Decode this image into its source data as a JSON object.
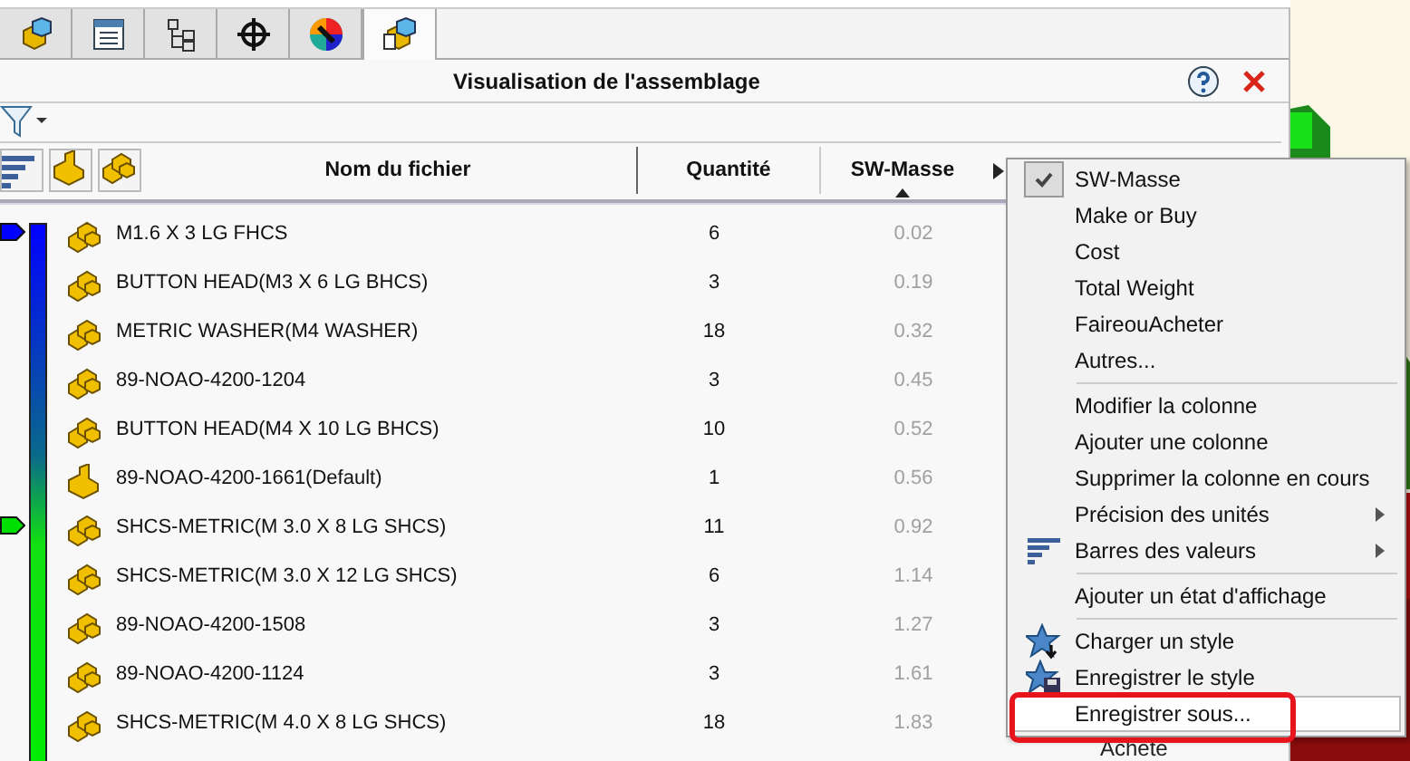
{
  "tabs": [
    {
      "selected": false
    },
    {
      "selected": false
    },
    {
      "selected": false
    },
    {
      "selected": false
    },
    {
      "selected": false
    },
    {
      "selected": true
    }
  ],
  "panel": {
    "title": "Visualisation de l'assemblage"
  },
  "table": {
    "columns": [
      {
        "label": "Nom du fichier",
        "sorted": false
      },
      {
        "label": "Quantité",
        "sorted": false
      },
      {
        "label": "SW-Masse",
        "sorted": true
      }
    ],
    "rows": [
      {
        "kind": "multi",
        "name": "M1.6 X 3 LG FHCS",
        "qty": "6",
        "mass": "0.02",
        "marker": true,
        "color": "#0000ff"
      },
      {
        "kind": "multi",
        "name": "BUTTON HEAD(M3 X 6 LG BHCS)",
        "qty": "3",
        "mass": "0.19",
        "marker": false
      },
      {
        "kind": "multi",
        "name": "METRIC WASHER(M4 WASHER)",
        "qty": "18",
        "mass": "0.32",
        "marker": false
      },
      {
        "kind": "multi",
        "name": "89-NOAO-4200-1204",
        "qty": "3",
        "mass": "0.45",
        "marker": false
      },
      {
        "kind": "multi",
        "name": "BUTTON HEAD(M4 X 10 LG BHCS)",
        "qty": "10",
        "mass": "0.52",
        "marker": false
      },
      {
        "kind": "part",
        "name": "89-NOAO-4200-1661(Default)",
        "qty": "1",
        "mass": "0.56",
        "marker": false
      },
      {
        "kind": "multi",
        "name": "SHCS-METRIC(M 3.0  X 8 LG SHCS)",
        "qty": "11",
        "mass": "0.92",
        "marker": true,
        "color": "#00e000"
      },
      {
        "kind": "multi",
        "name": "SHCS-METRIC(M 3.0  X 12 LG SHCS)",
        "qty": "6",
        "mass": "1.14",
        "marker": false
      },
      {
        "kind": "multi",
        "name": "89-NOAO-4200-1508",
        "qty": "3",
        "mass": "1.27",
        "marker": false
      },
      {
        "kind": "multi",
        "name": "89-NOAO-4200-1124",
        "qty": "3",
        "mass": "1.61",
        "marker": false
      },
      {
        "kind": "multi",
        "name": "SHCS-METRIC(M 4.0 X 8 LG SHCS)",
        "qty": "18",
        "mass": "1.83",
        "marker": false
      }
    ]
  },
  "menu": {
    "items": [
      {
        "kind": "check",
        "label": "SW-Masse",
        "checked": true,
        "selected": false,
        "circled": false
      },
      {
        "kind": "plain",
        "label": "Make or Buy",
        "selected": false,
        "circled": false
      },
      {
        "kind": "plain",
        "label": "Cost",
        "selected": false,
        "circled": false
      },
      {
        "kind": "plain",
        "label": "Total Weight",
        "selected": false,
        "circled": false
      },
      {
        "kind": "plain",
        "label": "FaireouAcheter",
        "selected": false,
        "circled": false
      },
      {
        "kind": "plain",
        "label": "Autres...",
        "selected": false,
        "circled": false
      },
      {
        "kind": "separator"
      },
      {
        "kind": "plain",
        "label": "Modifier la colonne",
        "selected": false,
        "circled": false
      },
      {
        "kind": "plain",
        "label": "Ajouter une colonne",
        "selected": false,
        "circled": false
      },
      {
        "kind": "plain",
        "label": "Supprimer la colonne en cours",
        "selected": false,
        "circled": false
      },
      {
        "kind": "submenu",
        "label": "Précision des unités",
        "selected": false,
        "circled": false
      },
      {
        "kind": "bars-submenu",
        "label": "Barres des valeurs",
        "selected": false,
        "circled": false
      },
      {
        "kind": "separator"
      },
      {
        "kind": "plain",
        "label": "Ajouter un état d'affichage",
        "selected": false,
        "circled": false
      },
      {
        "kind": "separator"
      },
      {
        "kind": "load-style",
        "label": "Charger un style",
        "selected": false,
        "circled": false
      },
      {
        "kind": "save-style",
        "label": "Enregistrer le style",
        "selected": false,
        "circled": false
      },
      {
        "kind": "plain",
        "label": "Enregistrer sous...",
        "selected": true,
        "circled": true
      }
    ]
  },
  "below_menu": {
    "text": "Achete"
  }
}
